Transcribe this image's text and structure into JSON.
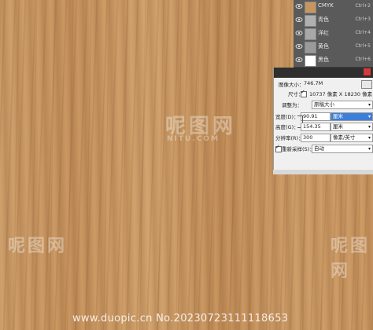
{
  "watermark": {
    "logo": "呢图网",
    "sub": "NITU.COM",
    "footer": "www.duopic.cn No.20230723111118653"
  },
  "layers": [
    {
      "name": "CMYK",
      "shortcut": "Ctrl+2",
      "thumb_color": "#c8955f"
    },
    {
      "name": "青色",
      "shortcut": "Ctrl+3",
      "thumb_color": "#b0b0b0"
    },
    {
      "name": "洋红",
      "shortcut": "Ctrl+4",
      "thumb_color": "#a8a8a8"
    },
    {
      "name": "黄色",
      "shortcut": "Ctrl+5",
      "thumb_color": "#9a9a9a"
    },
    {
      "name": "黑色",
      "shortcut": "Ctrl+6",
      "thumb_color": "#ffffff"
    }
  ],
  "dialog": {
    "image_size_label": "图像大小：",
    "image_size_value": "746.7M",
    "dimensions_label": "尺寸：",
    "dimensions_value": "10737 像素 X 18230 像素",
    "fit_label": "调整为：",
    "fit_value": "原稿大小",
    "width_label": "宽度(D)：",
    "width_value": "90.91",
    "width_unit": "厘米",
    "height_label": "高度(G)：",
    "height_value": "154.35",
    "height_unit": "厘米",
    "resolution_label": "分辨率(R)：",
    "resolution_value": "300",
    "resolution_unit": "像素/英寸",
    "resample_label": "重新采样(S)：",
    "resample_value": "自动"
  },
  "colors": {
    "wood_base": "#c8955f",
    "panel_bg": "#535353",
    "dialog_bg": "#f0f0f0",
    "highlight": "#3b7fd8"
  }
}
